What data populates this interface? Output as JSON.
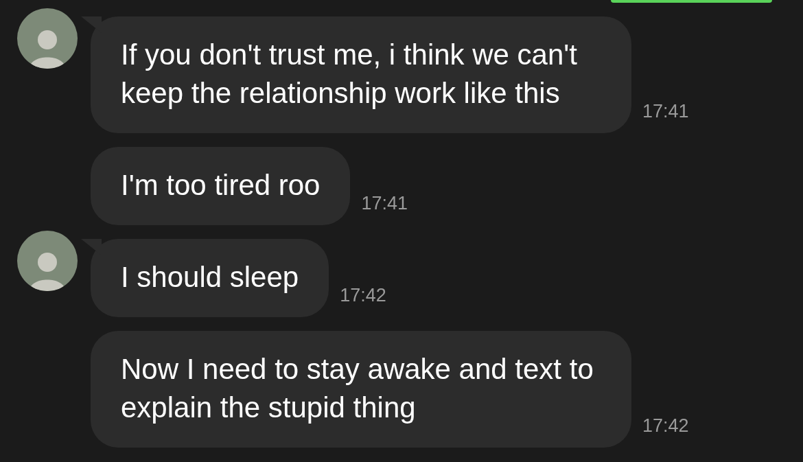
{
  "messages": [
    {
      "avatar": true,
      "text": "If you don't trust me, i think we can't keep the relationship work like this",
      "time": "17:41"
    },
    {
      "avatar": false,
      "text": "I'm too tired roo",
      "time": "17:41"
    },
    {
      "avatar": true,
      "text": "I should sleep",
      "time": "17:42"
    },
    {
      "avatar": false,
      "text": "Now I need to stay awake and text to explain the stupid thing",
      "time": "17:42"
    }
  ]
}
